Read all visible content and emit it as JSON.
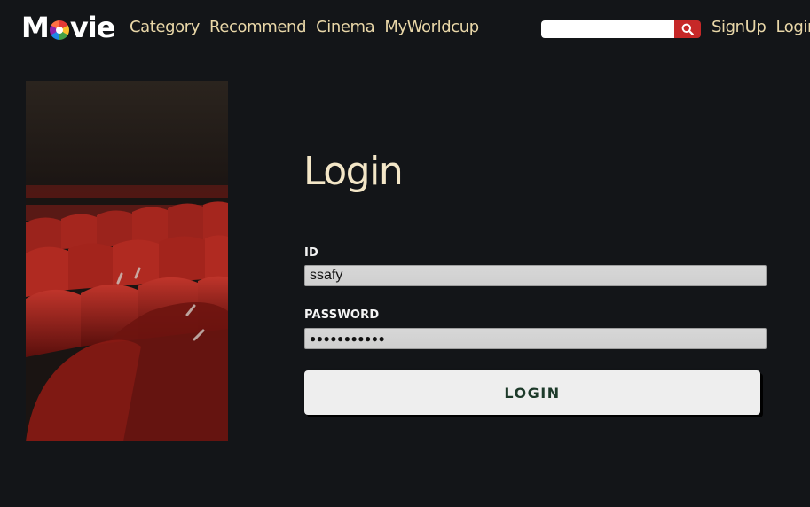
{
  "brand": {
    "logo_text_left": "M",
    "logo_text_right": "vie"
  },
  "nav": {
    "links": [
      "Category",
      "Recommend",
      "Cinema",
      "MyWorldcup"
    ]
  },
  "search": {
    "placeholder": "",
    "value": "",
    "icon": "search-icon"
  },
  "auth": {
    "signup_label": "SignUp",
    "login_label": "Login"
  },
  "hero": {
    "image_alt": "Rows of red cinema seats",
    "seat_color": "#b3261e"
  },
  "form": {
    "title": "Login",
    "id_label": "ID",
    "id_value": "ssafy",
    "password_label": "PASSWORD",
    "password_value": "●●●●●●●●●●●",
    "submit_label": "LOGIN"
  },
  "colors": {
    "background": "#131518",
    "nav_link": "#e9d7a8",
    "title": "#f3e6c7",
    "search_button": "#c62828",
    "button_text": "#1d3a2a"
  }
}
